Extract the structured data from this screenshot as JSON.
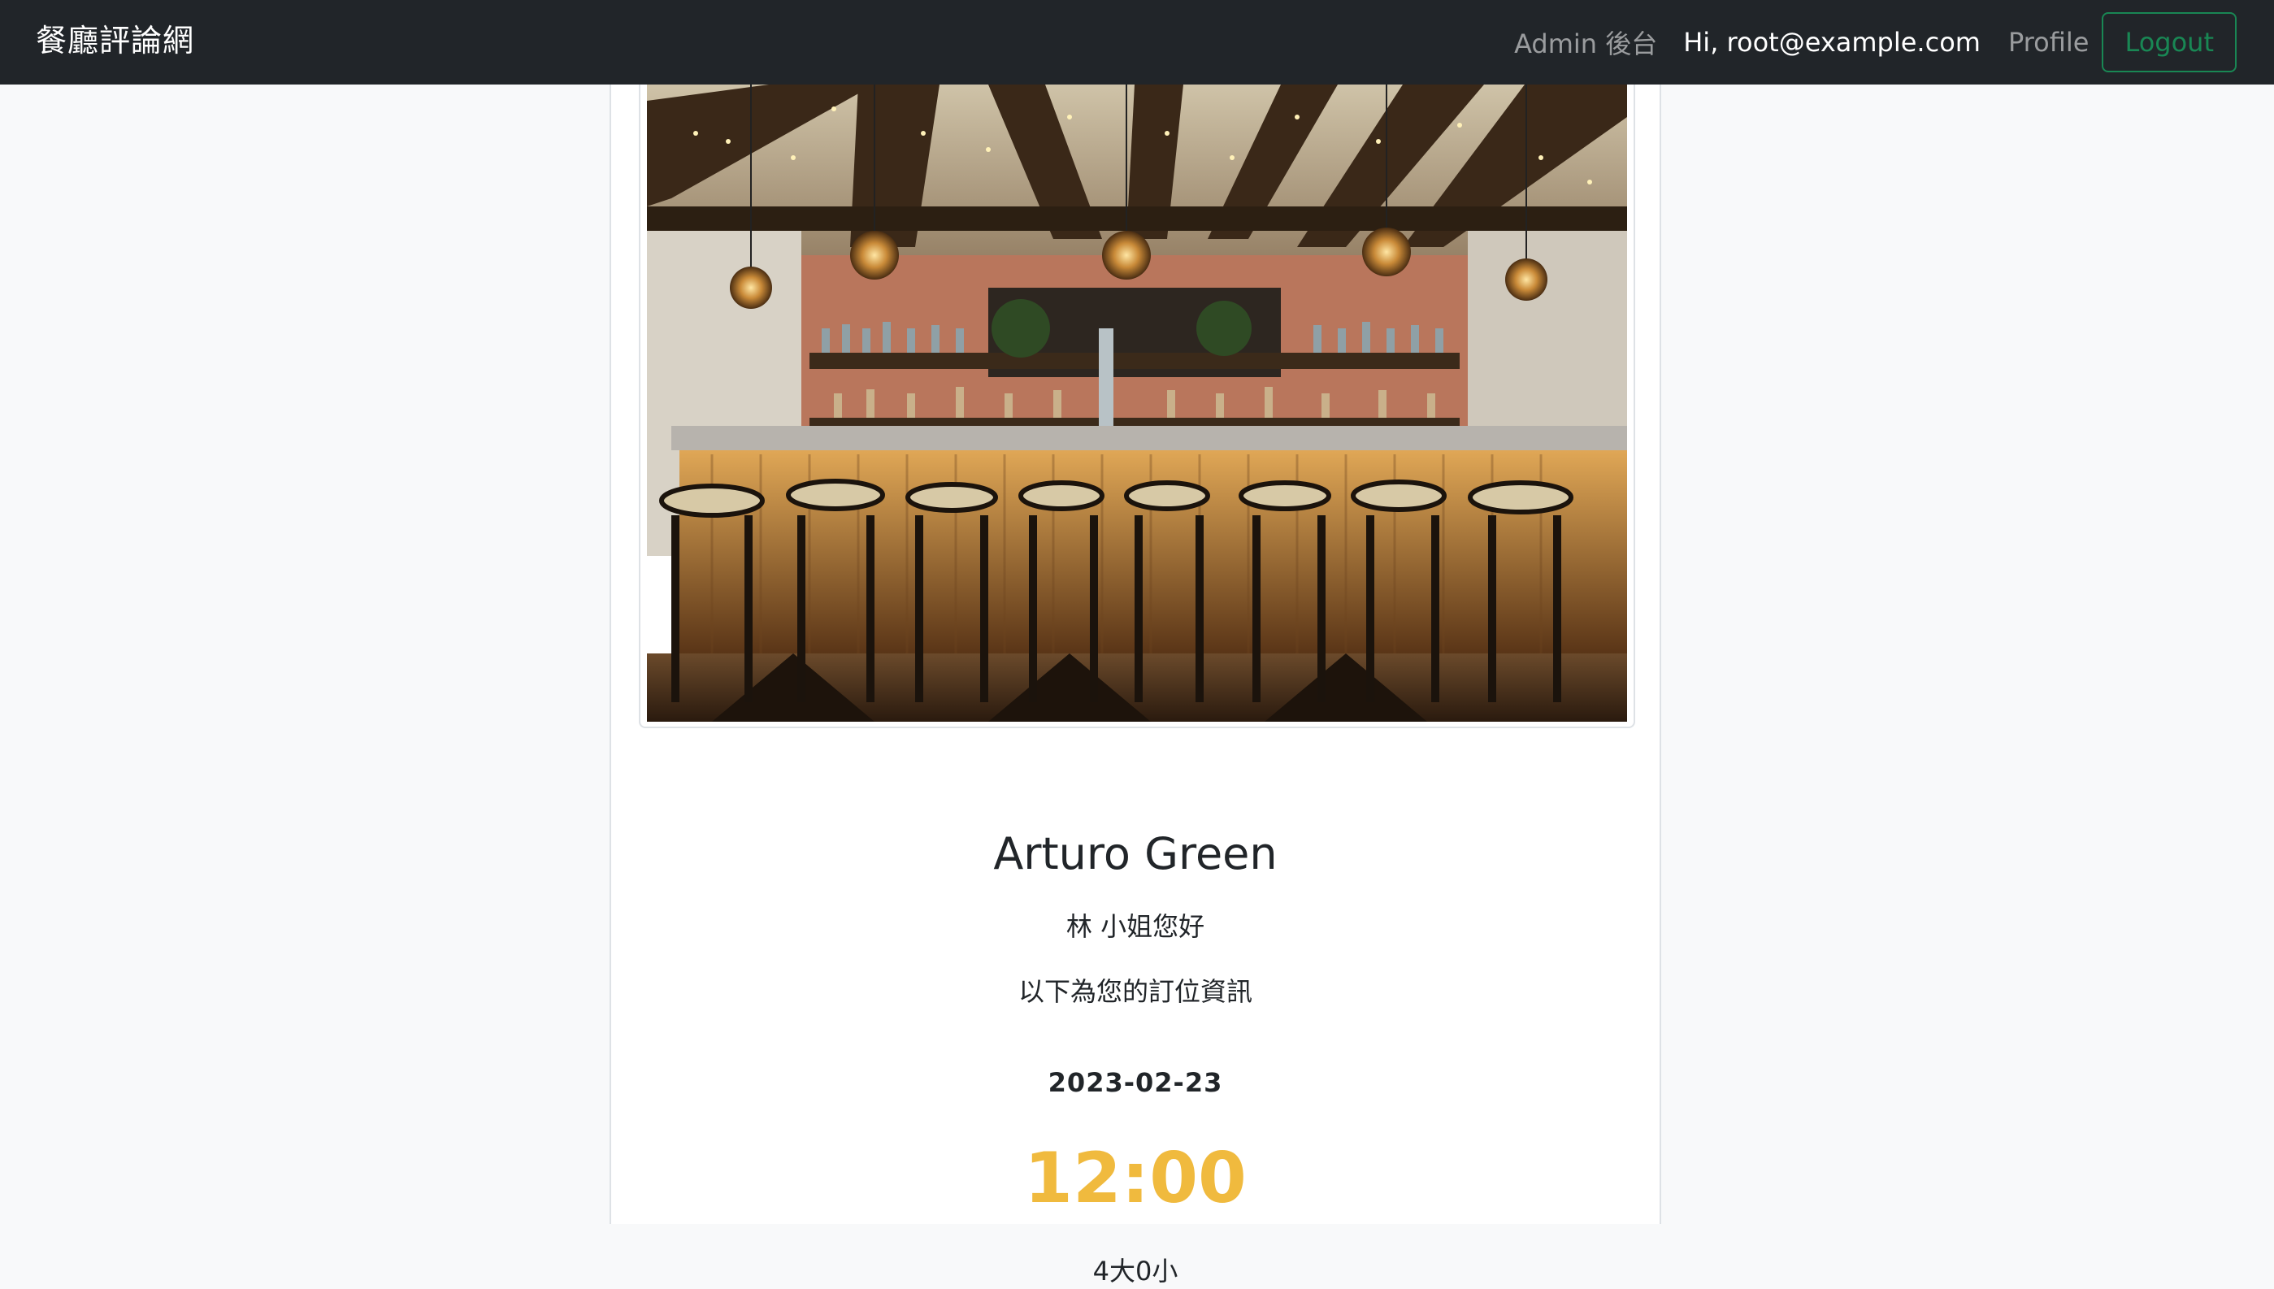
{
  "navbar": {
    "brand": "餐廳評論網",
    "admin_link": "Admin 後台",
    "greeting": "Hi, root@example.com",
    "profile_link": "Profile",
    "logout_label": "Logout"
  },
  "reservation": {
    "restaurant_name": "Arturo Green",
    "greeting": "林 小姐您好",
    "info_line": "以下為您的訂位資訊",
    "date": "2023-02-23",
    "time": "12:00",
    "party_size": "4大0小"
  },
  "colors": {
    "navbar_bg": "#212529",
    "logout_border": "#198754",
    "time_accent": "#f0ba3e"
  }
}
